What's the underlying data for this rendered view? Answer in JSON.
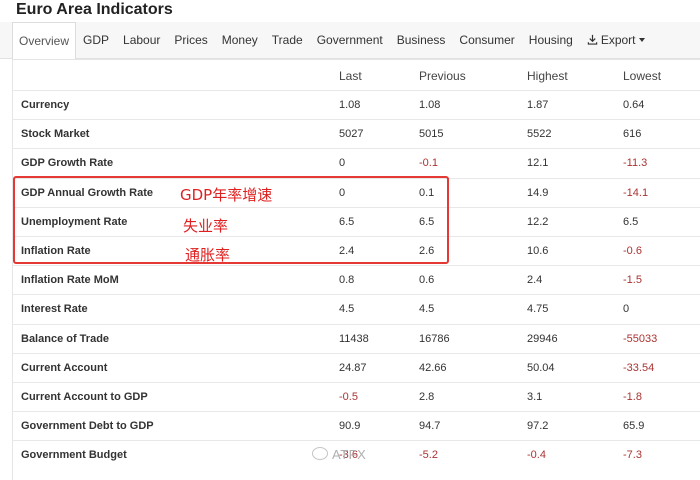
{
  "page": {
    "title": "Euro Area Indicators"
  },
  "tabs": [
    {
      "label": "Overview",
      "active": true
    },
    {
      "label": "GDP"
    },
    {
      "label": "Labour"
    },
    {
      "label": "Prices"
    },
    {
      "label": "Money"
    },
    {
      "label": "Trade"
    },
    {
      "label": "Government"
    },
    {
      "label": "Business"
    },
    {
      "label": "Consumer"
    },
    {
      "label": "Housing"
    },
    {
      "label": "Export",
      "icon": "download-icon",
      "dropdown": true
    }
  ],
  "table": {
    "headers": [
      "",
      "Last",
      "Previous",
      "Highest",
      "Lowest"
    ],
    "rows": [
      {
        "name": "Currency",
        "last": "1.08",
        "previous": "1.08",
        "highest": "1.87",
        "lowest": "0.64"
      },
      {
        "name": "Stock Market",
        "last": "5027",
        "previous": "5015",
        "highest": "5522",
        "lowest": "616"
      },
      {
        "name": "GDP Growth Rate",
        "last": "0",
        "previous": "-0.1",
        "highest": "12.1",
        "lowest": "-11.3"
      },
      {
        "name": "GDP Annual Growth Rate",
        "last": "0",
        "previous": "0.1",
        "highest": "14.9",
        "lowest": "-14.1"
      },
      {
        "name": "Unemployment Rate",
        "last": "6.5",
        "previous": "6.5",
        "highest": "12.2",
        "lowest": "6.5"
      },
      {
        "name": "Inflation Rate",
        "last": "2.4",
        "previous": "2.6",
        "highest": "10.6",
        "lowest": "-0.6"
      },
      {
        "name": "Inflation Rate MoM",
        "last": "0.8",
        "previous": "0.6",
        "highest": "2.4",
        "lowest": "-1.5"
      },
      {
        "name": "Interest Rate",
        "last": "4.5",
        "previous": "4.5",
        "highest": "4.75",
        "lowest": "0"
      },
      {
        "name": "Balance of Trade",
        "last": "11438",
        "previous": "16786",
        "highest": "29946",
        "lowest": "-55033"
      },
      {
        "name": "Current Account",
        "last": "24.87",
        "previous": "42.66",
        "highest": "50.04",
        "lowest": "-33.54"
      },
      {
        "name": "Current Account to GDP",
        "last": "-0.5",
        "previous": "2.8",
        "highest": "3.1",
        "lowest": "-1.8"
      },
      {
        "name": "Government Debt to GDP",
        "last": "90.9",
        "previous": "94.7",
        "highest": "97.2",
        "lowest": "65.9"
      },
      {
        "name": "Government Budget",
        "last": "-3.6",
        "previous": "-5.2",
        "highest": "-0.4",
        "lowest": "-7.3"
      }
    ]
  },
  "annotations": {
    "gdp_annual": "GDP年率增速",
    "unemployment": "失业率",
    "inflation": "通胀率",
    "highlight_color": "#e53935"
  },
  "watermark": {
    "text": "ATFX"
  },
  "colors": {
    "negative": "#a33333",
    "annotation": "#e02020"
  }
}
